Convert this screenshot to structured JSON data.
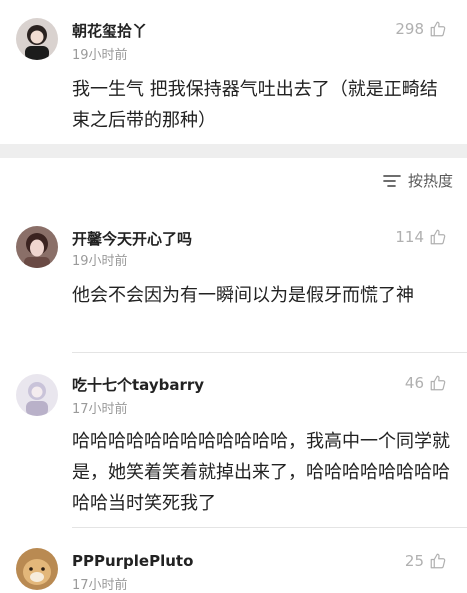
{
  "comments": [
    {
      "username": "朝花玺拾丫",
      "time": "19小时前",
      "likes": "298",
      "text": "我一生气 把我保持器气吐出去了（就是正畸结束之后带的那种）"
    },
    {
      "username": "开馨今天开心了吗",
      "time": "19小时前",
      "likes": "114",
      "text": "他会不会因为有一瞬间以为是假牙而慌了神"
    },
    {
      "username": "吃十七个taybarry",
      "time": "17小时前",
      "likes": "46",
      "text": "哈哈哈哈哈哈哈哈哈哈哈哈，我高中一个同学就是，她笑着笑着就掉出来了，哈哈哈哈哈哈哈哈哈哈当时笑死我了"
    },
    {
      "username": "PPPurplePluto",
      "time": "17小时前",
      "likes": "25",
      "text": ""
    }
  ],
  "sort": {
    "label": "按热度",
    "icon": "sort-icon"
  },
  "icons": {
    "like": "thumbs-up-icon",
    "avatar": "avatar"
  },
  "colors": {
    "meta": "#9a9a9a",
    "like": "#b0b0b0",
    "band": "#eeeeee"
  }
}
